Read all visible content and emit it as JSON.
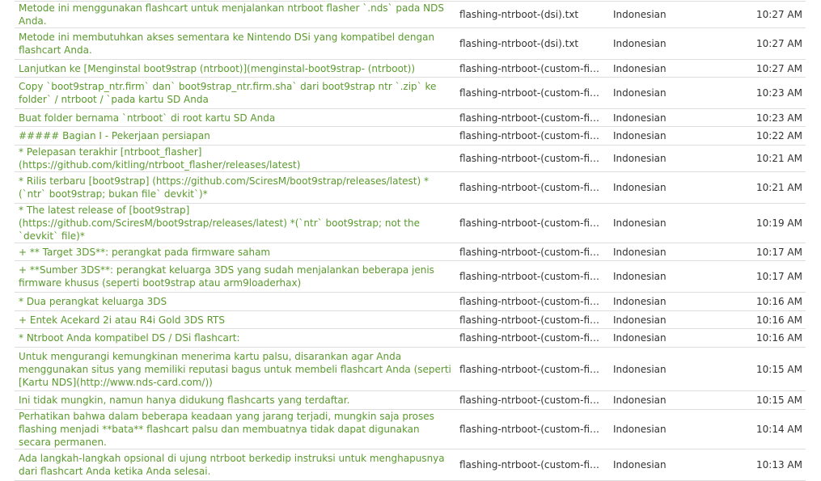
{
  "activity": {
    "rows": [
      {
        "text": "Metode ini menggunakan flashcart untuk menjalankan ntrboot flasher `.nds` pada NDS Anda.",
        "file": "flashing-ntrboot-(dsi).txt",
        "language": "Indonesian",
        "time": "10:27 AM"
      },
      {
        "text": "Metode ini membutuhkan akses sementara ke Nintendo DSi yang kompatibel dengan flashcart Anda.",
        "file": "flashing-ntrboot-(dsi).txt",
        "language": "Indonesian",
        "time": "10:27 AM"
      },
      {
        "text": "Lanjutkan ke [Menginstal boot9strap (ntrboot)](menginstal-boot9strap- (ntrboot))",
        "file": "flashing-ntrboot-(custom-firmwa...",
        "language": "Indonesian",
        "time": "10:27 AM"
      },
      {
        "text": "Copy `boot9strap_ntr.firm` dan` boot9strap_ntr.firm.sha` dari boot9strap ntr `.zip` ke folder` / ntrboot / `pada kartu SD Anda",
        "file": "flashing-ntrboot-(custom-firmwa...",
        "language": "Indonesian",
        "time": "10:23 AM"
      },
      {
        "text": "Buat folder bernama `ntrboot` di root kartu SD Anda",
        "file": "flashing-ntrboot-(custom-firmwa...",
        "language": "Indonesian",
        "time": "10:23 AM"
      },
      {
        "text": "##### Bagian I - Pekerjaan persiapan",
        "file": "flashing-ntrboot-(custom-firmwa...",
        "language": "Indonesian",
        "time": "10:22 AM"
      },
      {
        "text": "* Pelepasan terakhir [ntrboot_flasher] (https://github.com/kitling/ntrboot_flasher/releases/latest)",
        "file": "flashing-ntrboot-(custom-firmwa...",
        "language": "Indonesian",
        "time": "10:21 AM"
      },
      {
        "text": "* Rilis terbaru [boot9strap] (https://github.com/SciresM/boot9strap/releases/latest) *(`ntr` boot9strap; bukan file` devkit`)*",
        "file": "flashing-ntrboot-(custom-firmwa...",
        "language": "Indonesian",
        "time": "10:21 AM"
      },
      {
        "text": "* The latest release of [boot9strap](https://github.com/SciresM/boot9strap/releases/latest) *(`ntr` boot9strap; not the `devkit` file)*",
        "file": "flashing-ntrboot-(custom-firmwa...",
        "language": "Indonesian",
        "time": "10:19 AM"
      },
      {
        "text": "+ ** Target 3DS**: perangkat pada firmware saham",
        "file": "flashing-ntrboot-(custom-firmwa...",
        "language": "Indonesian",
        "time": "10:17 AM"
      },
      {
        "text": "+ **Sumber 3DS**: perangkat keluarga 3DS yang sudah menjalankan beberapa jenis firmware khusus (seperti boot9strap atau arm9loaderhax)",
        "file": "flashing-ntrboot-(custom-firmwa...",
        "language": "Indonesian",
        "time": "10:17 AM"
      },
      {
        "text": "* Dua perangkat keluarga 3DS",
        "file": "flashing-ntrboot-(custom-firmwa...",
        "language": "Indonesian",
        "time": "10:16 AM"
      },
      {
        "text": "+ Entek Acekard 2i atau R4i Gold 3DS RTS",
        "file": "flashing-ntrboot-(custom-firmwa...",
        "language": "Indonesian",
        "time": "10:16 AM"
      },
      {
        "text": "* Ntrboot Anda kompatibel DS / DSi flashcart:",
        "file": "flashing-ntrboot-(custom-firmwa...",
        "language": "Indonesian",
        "time": "10:16 AM"
      },
      {
        "text": "Untuk mengurangi kemungkinan menerima kartu palsu, disarankan agar Anda menggunakan situs yang memiliki reputasi bagus untuk membeli flashcart Anda (seperti [Kartu NDS](http://www.nds-card.com/))",
        "file": "flashing-ntrboot-(custom-firmwa...",
        "language": "Indonesian",
        "time": "10:15 AM"
      },
      {
        "text": "Ini tidak mungkin, namun hanya didukung flashcarts yang terdaftar.",
        "file": "flashing-ntrboot-(custom-firmwa...",
        "language": "Indonesian",
        "time": "10:15 AM"
      },
      {
        "text": "Perhatikan bahwa dalam beberapa keadaan yang jarang terjadi, mungkin saja proses flashing menjadi **bata** flashcart palsu dan membuatnya tidak dapat digunakan secara permanen.",
        "file": "flashing-ntrboot-(custom-firmwa...",
        "language": "Indonesian",
        "time": "10:14 AM"
      },
      {
        "text": "Ada langkah-langkah opsional di ujung ntrboot berkedip instruksi untuk menghapusnya dari flashcart Anda ketika Anda selesai.",
        "file": "flashing-ntrboot-(custom-firmwa...",
        "language": "Indonesian",
        "time": "10:13 AM"
      }
    ]
  }
}
